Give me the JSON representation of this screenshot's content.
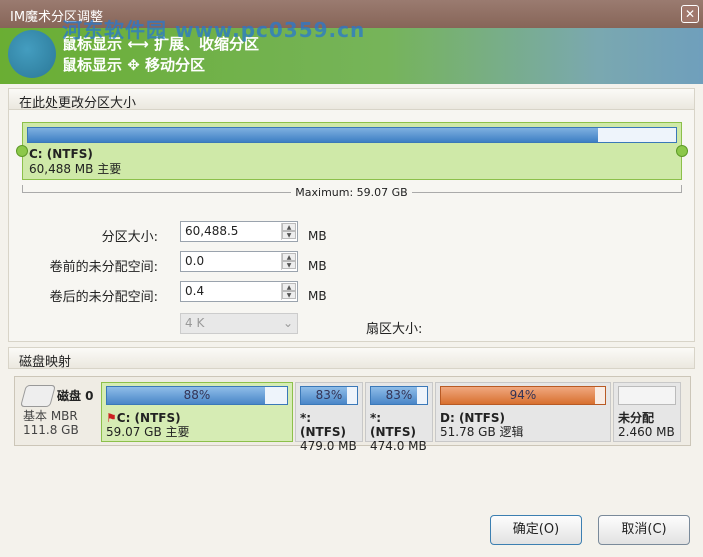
{
  "window": {
    "title": "IM魔术分区调整",
    "close": "✕"
  },
  "banner": {
    "line1": "鼠标显示 ⟷ 扩展、收缩分区",
    "line2": "鼠标显示 ✥ 移动分区",
    "watermark": "河东软件园 www.pc0359.cn"
  },
  "resize": {
    "header": "在此处更改分区大小",
    "partition_name": "C: (NTFS)",
    "partition_info": "60,488 MB 主要",
    "fill_percent": 88,
    "maximum": "Maximum: 59.07 GB"
  },
  "form": {
    "size_label": "分区大小:",
    "size_value": "60,488.5",
    "size_unit": "MB",
    "before_label": "卷前的未分配空间:",
    "before_value": "0.0",
    "before_unit": "MB",
    "after_label": "卷后的未分配空间:",
    "after_value": "0.4",
    "after_unit": "MB",
    "cluster_value": "4 K",
    "sector_label": "扇区大小:"
  },
  "diskmap": {
    "header": "磁盘映射",
    "disk_name": "磁盘 0",
    "disk_type": "基本 MBR",
    "disk_size": "111.8 GB",
    "partitions": [
      {
        "pct": "88%",
        "fill": 88,
        "name": "C: (NTFS)",
        "info": "59.07 GB 主要"
      },
      {
        "pct": "83%",
        "fill": 83,
        "name": "*: (NTFS)",
        "info": "479.0 MB"
      },
      {
        "pct": "83%",
        "fill": 83,
        "name": "*: (NTFS)",
        "info": "474.0 MB"
      },
      {
        "pct": "94%",
        "fill": 94,
        "name": "D: (NTFS)",
        "info": "51.78 GB 逻辑"
      },
      {
        "pct": "",
        "fill": 0,
        "name": "未分配",
        "info": "2.460 MB"
      }
    ]
  },
  "buttons": {
    "ok": "确定(O)",
    "cancel": "取消(C)"
  }
}
